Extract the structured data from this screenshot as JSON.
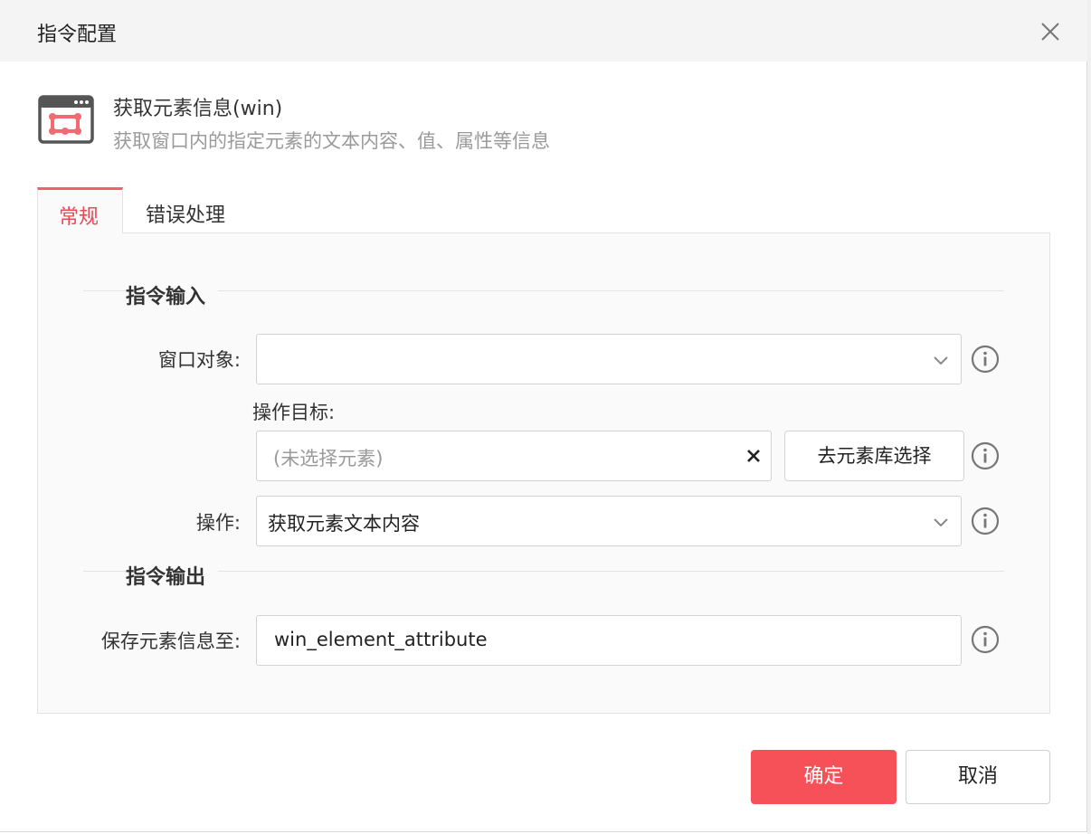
{
  "dialog": {
    "title": "指令配置",
    "close_icon": "close-icon"
  },
  "command": {
    "icon": "window-element-icon",
    "name": "获取元素信息(win)",
    "description": "获取窗口内的指定元素的文本内容、值、属性等信息"
  },
  "tabs": [
    {
      "label": "常规",
      "active": true
    },
    {
      "label": "错误处理",
      "active": false
    }
  ],
  "sections": {
    "input": "指令输入",
    "output": "指令输出"
  },
  "fields": {
    "window_object": {
      "label": "窗口对象:",
      "value": ""
    },
    "target": {
      "label": "操作目标:",
      "placeholder": "(未选择元素)",
      "library_button": "去元素库选择"
    },
    "operation": {
      "label": "操作:",
      "value": "获取元素文本内容"
    },
    "save_to": {
      "label": "保存元素信息至:",
      "value": "win_element_attribute"
    }
  },
  "footer": {
    "ok_label": "确定",
    "cancel_label": "取消"
  },
  "colors": {
    "accent": "#f65058",
    "tab_active": "#e84a55"
  }
}
